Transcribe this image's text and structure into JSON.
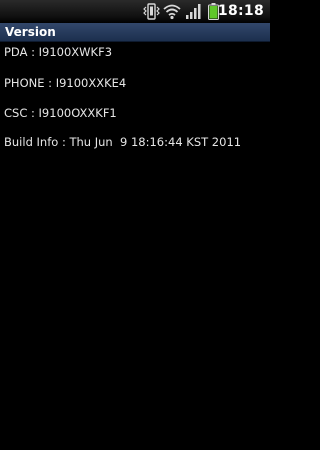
{
  "status_bar": {
    "time": "18:18",
    "icons": [
      "vibrate-icon",
      "wifi-icon",
      "signal-icon",
      "battery-icon"
    ],
    "battery_color": "#5fc72a"
  },
  "title_bar": {
    "title": "Version",
    "color": "#2a3e60"
  },
  "info": {
    "pda": "PDA : I9100XWKF3",
    "phone": "PHONE : I9100XXKE4",
    "csc": "CSC : I9100OXXKF1",
    "build": "Build Info : Thu Jun  9 18:16:44 KST 2011"
  }
}
